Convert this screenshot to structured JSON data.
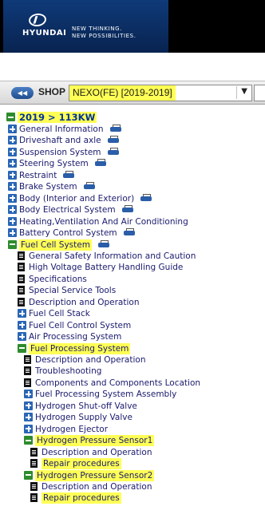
{
  "header": {
    "brand": "HYUNDAI",
    "tagline1": "NEW THINKING.",
    "tagline2": "NEW POSSIBILITIES."
  },
  "shop": {
    "back_label": "◀◀",
    "label": "SHOP",
    "selected_model": "NEXO(FE) [2019-2019]",
    "dropdown_arrow": "▼"
  },
  "tree": {
    "root": "2019 > 113KW",
    "items": [
      {
        "label": "General Information",
        "icon": "plus",
        "indent": 1,
        "printer": true
      },
      {
        "label": "Driveshaft and axle",
        "icon": "plus",
        "indent": 1,
        "printer": true
      },
      {
        "label": "Suspension System",
        "icon": "plus",
        "indent": 1,
        "printer": true
      },
      {
        "label": "Steering System",
        "icon": "plus",
        "indent": 1,
        "printer": true
      },
      {
        "label": "Restraint",
        "icon": "plus",
        "indent": 1,
        "printer": true
      },
      {
        "label": "Brake System",
        "icon": "plus",
        "indent": 1,
        "printer": true
      },
      {
        "label": "Body (Interior and Exterior)",
        "icon": "plus",
        "indent": 1,
        "printer": true
      },
      {
        "label": "Body Electrical System",
        "icon": "plus",
        "indent": 1,
        "printer": true
      },
      {
        "label": "Heating,Ventilation And Air Conditioning",
        "icon": "plus",
        "indent": 1,
        "printer": false
      },
      {
        "label": "Battery Control System",
        "icon": "plus",
        "indent": 1,
        "printer": true
      },
      {
        "label": "Fuel Cell System",
        "icon": "minus",
        "indent": 1,
        "printer": true,
        "highlight": true
      },
      {
        "label": "General Safety Information and Caution",
        "icon": "doc",
        "indent": 2
      },
      {
        "label": "High Voltage Battery Handling Guide",
        "icon": "doc",
        "indent": 2
      },
      {
        "label": "Specifications",
        "icon": "doc",
        "indent": 2
      },
      {
        "label": "Special Service Tools",
        "icon": "doc",
        "indent": 2
      },
      {
        "label": "Description and Operation",
        "icon": "doc",
        "indent": 2
      },
      {
        "label": "Fuel Cell Stack",
        "icon": "plus",
        "indent": 2
      },
      {
        "label": "Fuel Cell Control System",
        "icon": "plus",
        "indent": 2
      },
      {
        "label": "Air Processing System",
        "icon": "plus",
        "indent": 2
      },
      {
        "label": "Fuel Processing System",
        "icon": "minus",
        "indent": 2,
        "highlight": true
      },
      {
        "label": "Description and Operation",
        "icon": "doc",
        "indent": 3
      },
      {
        "label": "Troubleshooting",
        "icon": "doc",
        "indent": 3
      },
      {
        "label": "Components and Components Location",
        "icon": "doc",
        "indent": 3
      },
      {
        "label": "Fuel Processing System Assembly",
        "icon": "plus",
        "indent": 3
      },
      {
        "label": "Hydrogen Shut-off Valve",
        "icon": "plus",
        "indent": 3
      },
      {
        "label": "Hydrogen Supply Valve",
        "icon": "plus",
        "indent": 3
      },
      {
        "label": "Hydrogen Ejector",
        "icon": "plus",
        "indent": 3
      },
      {
        "label": "Hydrogen Pressure Sensor1",
        "icon": "minus",
        "indent": 3,
        "highlight": true
      },
      {
        "label": "Description and Operation",
        "icon": "doc",
        "indent": 4
      },
      {
        "label": "Repair procedures",
        "icon": "doc",
        "indent": 4,
        "highlight": true
      },
      {
        "label": "Hydrogen Pressure Sensor2",
        "icon": "minus",
        "indent": 3,
        "highlight": true
      },
      {
        "label": "Description and Operation",
        "icon": "doc",
        "indent": 4
      },
      {
        "label": "Repair procedures",
        "icon": "doc",
        "indent": 4,
        "highlight": true
      }
    ]
  }
}
